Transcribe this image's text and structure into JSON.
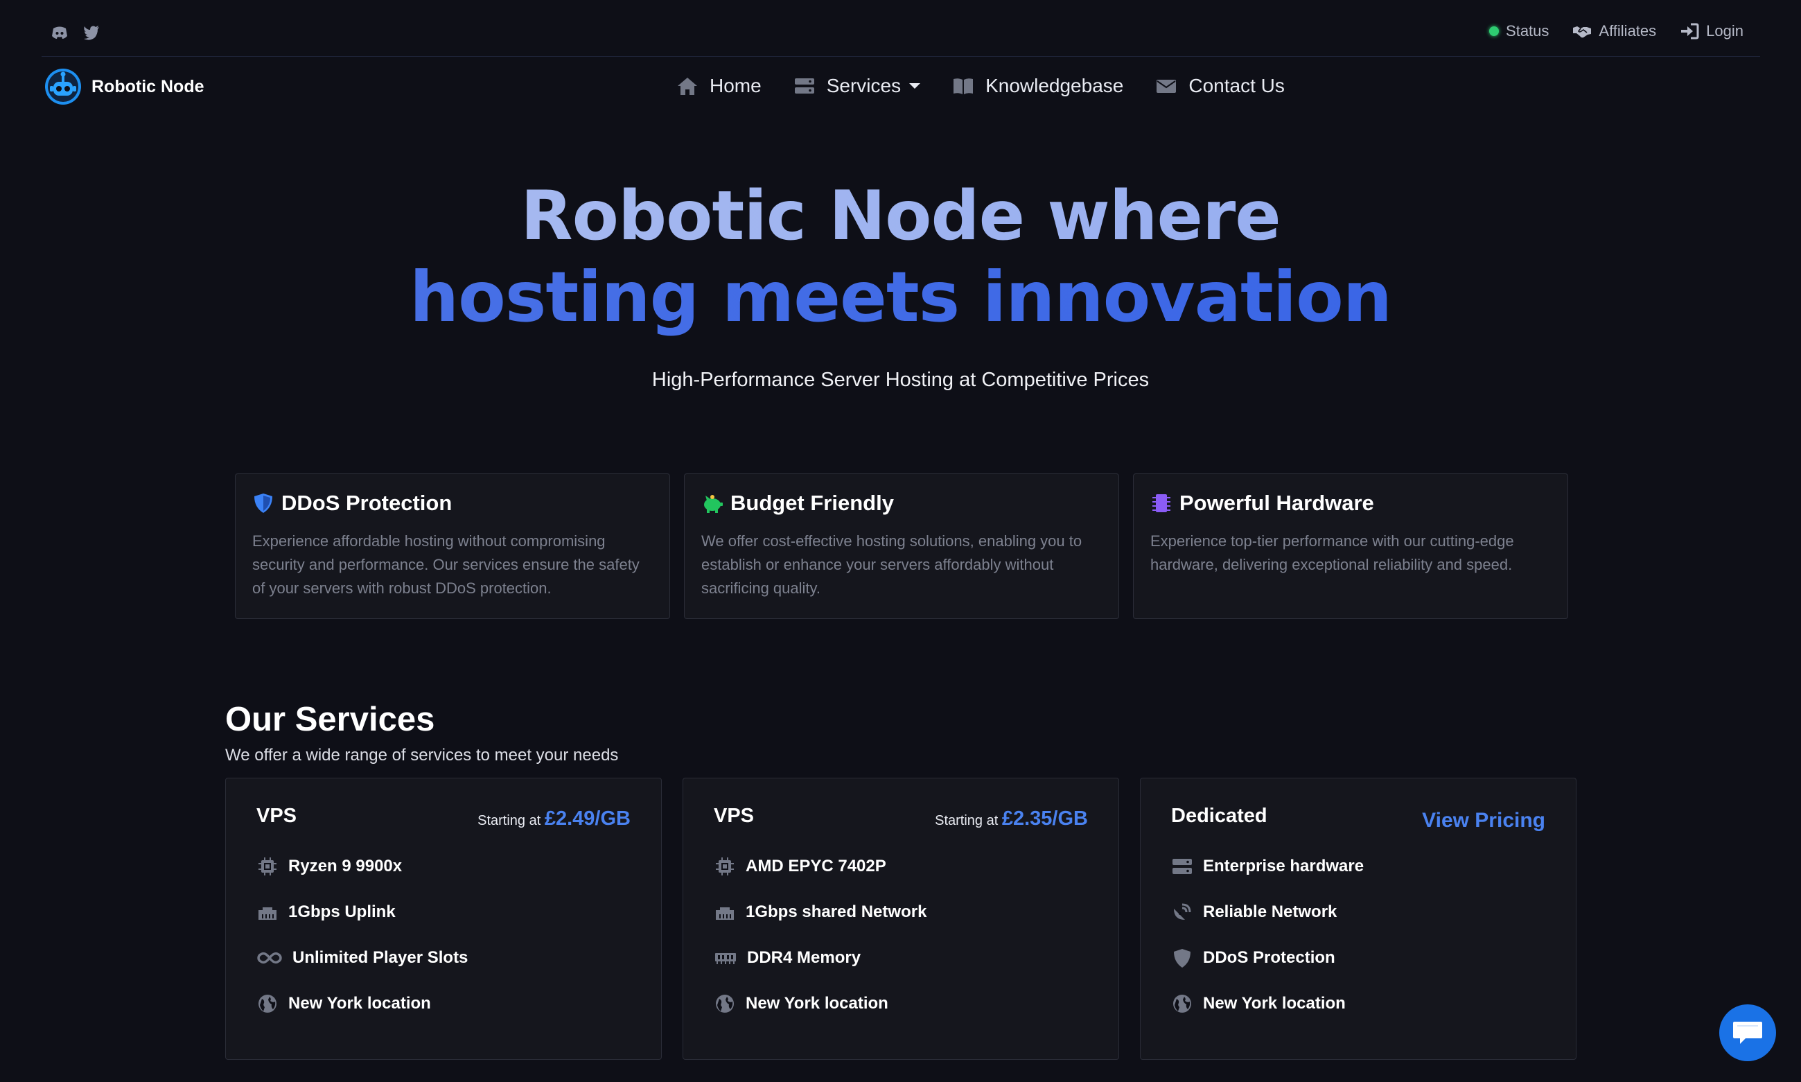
{
  "topbar": {
    "social": [
      {
        "icon": "discord-icon"
      },
      {
        "icon": "twitter-icon"
      }
    ],
    "status_label": "Status",
    "affiliates_label": "Affiliates",
    "login_label": "Login"
  },
  "brand": {
    "name": "Robotic Node"
  },
  "nav": {
    "home": "Home",
    "services": "Services",
    "knowledgebase": "Knowledgebase",
    "contact": "Contact Us"
  },
  "hero": {
    "line1": "Robotic Node where",
    "line2": "hosting meets innovation",
    "subtitle": "High-Performance Server Hosting at Competitive Prices"
  },
  "features": [
    {
      "icon": "shield-icon",
      "title": "DDoS Protection",
      "text": "Experience affordable hosting without compromising security and performance. Our services ensure the safety of your servers with robust DDoS protection.",
      "color": "#3b82f6"
    },
    {
      "icon": "piggy-bank-icon",
      "title": "Budget Friendly",
      "text": "We offer cost-effective hosting solutions, enabling you to establish or enhance your servers affordably without sacrificing quality.",
      "color": "#22c55e"
    },
    {
      "icon": "chip-icon",
      "title": "Powerful Hardware",
      "text": "Experience top-tier performance with our cutting-edge hardware, delivering exceptional reliability and speed.",
      "color": "#8b5cf6"
    }
  ],
  "services": {
    "title": "Our Services",
    "subtitle": "We offer a wide range of services to meet your needs",
    "cards": [
      {
        "name": "VPS",
        "price_prefix": "Starting at",
        "price": "£2.49/GB",
        "features": [
          "Ryzen 9 9900x",
          "1Gbps Uplink",
          "Unlimited Player Slots",
          "New York location"
        ]
      },
      {
        "name": "VPS",
        "price_prefix": "Starting at",
        "price": "£2.35/GB",
        "features": [
          "AMD EPYC 7402P",
          "1Gbps shared Network",
          "DDR4 Memory",
          "New York location"
        ]
      },
      {
        "name": "Dedicated",
        "link": "View Pricing",
        "features": [
          "Enterprise hardware",
          "Reliable Network",
          "DDoS Protection",
          "New York location"
        ]
      }
    ]
  },
  "colors": {
    "accent": "#4a82f0",
    "background": "#0e0f17",
    "card": "#15161d",
    "status_online": "#2ecc71",
    "chat_button": "#1a72e6"
  }
}
